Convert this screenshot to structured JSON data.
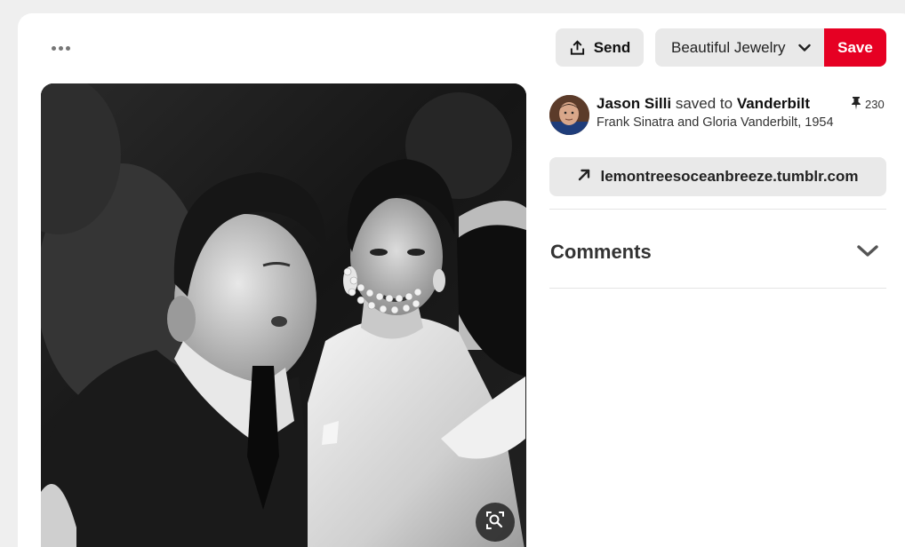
{
  "header": {
    "more_icon": "ellipsis-icon",
    "send_label": "Send",
    "send_icon": "share-upload-icon",
    "board_select": {
      "value": "Beautiful Jewelry",
      "icon": "chevron-down-icon"
    },
    "save_label": "Save",
    "save_color": "#e60023"
  },
  "pin": {
    "image_alt": "Frank Sinatra and Gloria Vanderbilt, 1954",
    "visual_search_icon": "magnifier-lens-icon",
    "attribution": {
      "user_name": "Jason Silli",
      "saved_to_text": "saved to",
      "board_name": "Vanderbilt"
    },
    "description": "Frank Sinatra and Gloria Vanderbilt, 1954",
    "save_count": "230",
    "save_count_icon": "pushpin-icon",
    "source_link": {
      "label": "lemontreesoceanbreeze.tumblr.com",
      "icon": "arrow-up-right-icon"
    }
  },
  "comments": {
    "title": "Comments",
    "toggle_icon": "chevron-down-icon"
  }
}
